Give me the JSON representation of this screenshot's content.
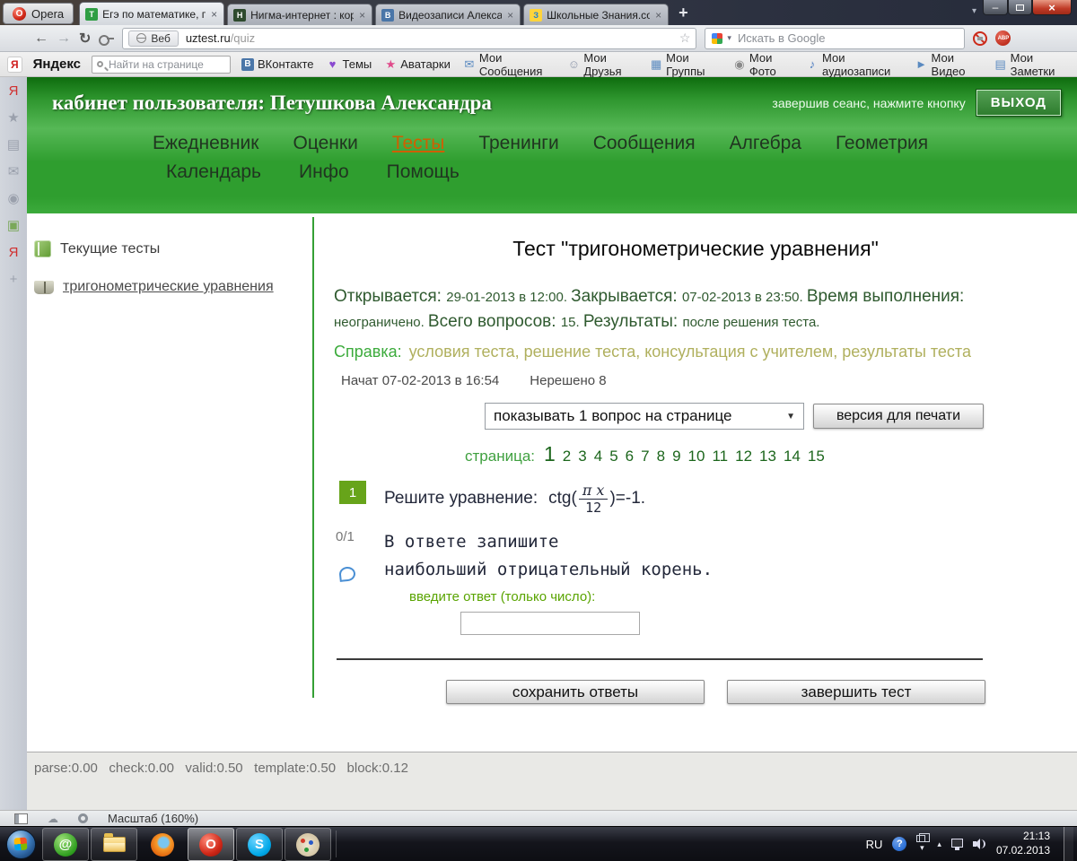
{
  "browser": {
    "menu_button": "Opera",
    "close_glyph": "×",
    "newtab_glyph": "+",
    "tabmenu_glyph": "▾",
    "min_glyph": "–",
    "winclose_glyph": "×",
    "tabs": [
      {
        "title": "Егэ по математике, по...",
        "fav": "Т",
        "fc": "#2f9e44",
        "tc": "#ffffff",
        "cls": "active"
      },
      {
        "title": "Нигма-интернет : кор...",
        "fav": "Н",
        "fc": "#2d4a2d",
        "tc": "#ffffff"
      },
      {
        "title": "Видеозаписи Алексан...",
        "fav": "В",
        "fc": "#4a76a8",
        "tc": "#ffffff"
      },
      {
        "title": "Школьные Знания.со...",
        "fav": "З",
        "fc": "#ffd43b",
        "tc": "#1c7ed6"
      }
    ],
    "toolbar": {
      "back_glyph": "←",
      "forward_glyph": "→",
      "reload_glyph": "↻",
      "badge": "Веб",
      "url_host": "uztest.ru",
      "url_path": "/quiz",
      "star_glyph": "☆",
      "search_placeholder": "Искать в Google",
      "search_caret": "▾",
      "abp_label": "ABP",
      "google_colors": [
        "#4285f4",
        "#ea4335",
        "#fbbc05",
        "#34a853"
      ]
    }
  },
  "yandex_bar": {
    "ya_letter": "Я",
    "logo": "Яндекс",
    "find_placeholder": "Найти на странице",
    "items": [
      {
        "label": "ВКонтакте",
        "glyph": "В",
        "color": "#ffffff",
        "bg": "#4a76a8",
        "sq": "sq"
      },
      {
        "label": "Темы",
        "glyph": "♥",
        "color": "#8a4ad0"
      },
      {
        "label": "Аватарки",
        "glyph": "★",
        "color": "#e04a8a"
      },
      {
        "label": "Мои Сообщения",
        "glyph": "✉",
        "color": "#5a8ac0"
      },
      {
        "label": "Мои Друзья",
        "glyph": "☺",
        "color": "#8a94a8"
      },
      {
        "label": "Мои Группы",
        "glyph": "▦",
        "color": "#5a8ac0"
      },
      {
        "label": "Мои Фото",
        "glyph": "◉",
        "color": "#8a8a8a"
      },
      {
        "label": "Мои аудиозаписи",
        "glyph": "♪",
        "color": "#4a7ac0"
      },
      {
        "label": "Мои Видео",
        "glyph": "►",
        "color": "#5a8ac0"
      },
      {
        "label": "Мои Заметки",
        "glyph": "▤",
        "color": "#5a8ac0"
      }
    ]
  },
  "side_strip": {
    "icons": [
      {
        "name": "yandex-icon",
        "glyph": "Я",
        "color": "#d03030"
      },
      {
        "name": "bookmarks-star-icon",
        "glyph": "★",
        "color": "#9aa0ac"
      },
      {
        "name": "panels-icon",
        "glyph": "▤",
        "color": "#9aa0ac"
      },
      {
        "name": "mail-panel-icon",
        "glyph": "✉",
        "color": "#9aa0ac"
      },
      {
        "name": "history-icon",
        "glyph": "◉",
        "color": "#9aa0ac"
      },
      {
        "name": "webcam-icon",
        "glyph": "▣",
        "color": "#7aa85a"
      },
      {
        "name": "yandex-bookmarks-icon",
        "glyph": "Я",
        "color": "#d03030"
      },
      {
        "name": "add-panel-icon",
        "glyph": "+",
        "color": "#9aa0ac"
      }
    ]
  },
  "page": {
    "header": {
      "title": "кабинет пользователя: Петушкова Александра",
      "logout_hint": "завершив сеанс, нажмите кнопку",
      "logout_button": "ВЫХОД",
      "nav_row1": [
        {
          "label": "Ежедневник"
        },
        {
          "label": "Оценки"
        },
        {
          "label": "Тесты",
          "cls": "active"
        },
        {
          "label": "Тренинги"
        },
        {
          "label": "Сообщения"
        },
        {
          "label": "Алгебра"
        },
        {
          "label": "Геометрия"
        }
      ],
      "nav_row2": [
        {
          "label": "Календарь"
        },
        {
          "label": "Инфо"
        },
        {
          "label": "Помощь"
        }
      ]
    },
    "sidebar": {
      "items": [
        {
          "label": "Текущие тесты",
          "icon": "current-tests-book-icon",
          "cls": "bk-closed"
        },
        {
          "label": "тригонометрические уравнения",
          "icon": "open-book-icon",
          "cls": "bk-open",
          "lcls": "ulink"
        }
      ]
    },
    "main": {
      "title": "Тест \"тригонометрические уравнения\"",
      "info_segments": [
        {
          "t": "Открывается: ",
          "s": "lg"
        },
        {
          "t": "29-01-2013 в 12:00. ",
          "s": "sm"
        },
        {
          "t": "Закрывается: ",
          "s": "lg"
        },
        {
          "t": "07-02-2013 в 23:50. ",
          "s": "sm"
        },
        {
          "t": "Время выполнения: ",
          "s": "lg"
        },
        {
          "t": "неограничено. ",
          "s": "sm"
        },
        {
          "t": "Всего вопросов: ",
          "s": "lg"
        },
        {
          "t": "15. ",
          "s": "sm"
        },
        {
          "t": "Результаты: ",
          "s": "lg"
        },
        {
          "t": "после решения теста.",
          "s": "sm"
        }
      ],
      "help_label": "Справка:",
      "help_links": [
        "условия теста,",
        "решение теста,",
        "консультация с учителем,",
        "результаты теста"
      ],
      "started": "Начат 07-02-2013 в 16:54",
      "unsolved": "Нерешено 8",
      "select_value": "показывать 1 вопрос на странице",
      "select_caret": "▼",
      "print_button": "версия для печати",
      "page_label": "страница:",
      "pages": [
        {
          "n": "1",
          "cls": "cur"
        },
        {
          "n": "2"
        },
        {
          "n": "3"
        },
        {
          "n": "4"
        },
        {
          "n": "5"
        },
        {
          "n": "6"
        },
        {
          "n": "7"
        },
        {
          "n": "8"
        },
        {
          "n": "9"
        },
        {
          "n": "10"
        },
        {
          "n": "11"
        },
        {
          "n": "12"
        },
        {
          "n": "13"
        },
        {
          "n": "14"
        },
        {
          "n": "15"
        }
      ],
      "question": {
        "number": "1",
        "score": "0/1",
        "prompt": "Решите уравнение:",
        "f_pre": "ctg(",
        "f_num": "π x",
        "f_den": "12",
        "f_post": ")=-1.",
        "line1": "В ответе запишите",
        "line2": "наибольший отрицательный корень.",
        "answer_label": "введите ответ (только число):"
      },
      "save_button": "сохранить ответы",
      "finish_button": "завершить тест"
    },
    "footer_debug": "parse:0.00   check:0.00   valid:0.50   template:0.50   block:0.12"
  },
  "statusbar": {
    "zoom_label": "Масштаб (160%)"
  },
  "taskbar": {
    "mail_glyph": "@",
    "opera_glyph": "O",
    "skype_glyph": "S",
    "tray": {
      "lang": "RU",
      "help_glyph": "?",
      "overflow_glyph": "▾",
      "collapse_glyph": "▴",
      "time": "21:13",
      "date": "07.02.2013"
    }
  }
}
